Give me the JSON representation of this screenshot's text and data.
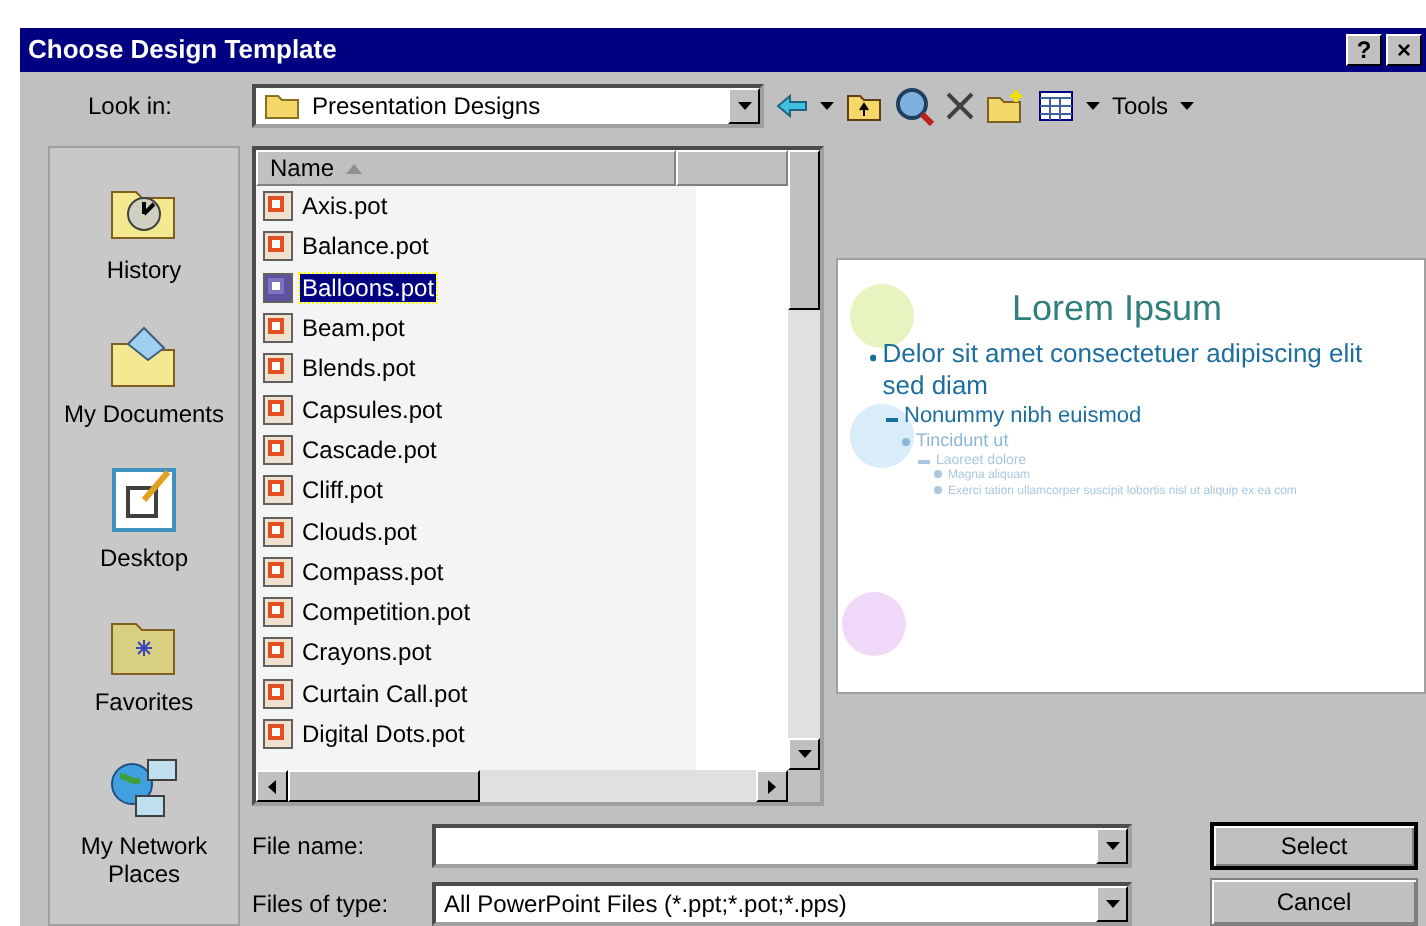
{
  "window": {
    "title": "Choose Design Template",
    "title_buttons": [
      "?",
      "×"
    ]
  },
  "look_in": {
    "label": "Look in:",
    "value": "Presentation Designs"
  },
  "toolbar": {
    "tools_label": "Tools"
  },
  "places": [
    {
      "label": "History",
      "kind": "history"
    },
    {
      "label": "My Documents",
      "kind": "documents"
    },
    {
      "label": "Desktop",
      "kind": "desktop"
    },
    {
      "label": "Favorites",
      "kind": "favorites"
    },
    {
      "label": "My Network Places",
      "kind": "network"
    }
  ],
  "file_list": {
    "column": "Name",
    "files": [
      {
        "name": "Axis.pot",
        "selected": false
      },
      {
        "name": "Balance.pot",
        "selected": false
      },
      {
        "name": "Balloons.pot",
        "selected": true
      },
      {
        "name": "Beam.pot",
        "selected": false
      },
      {
        "name": "Blends.pot",
        "selected": false
      },
      {
        "name": "Capsules.pot",
        "selected": false
      },
      {
        "name": "Cascade.pot",
        "selected": false
      },
      {
        "name": "Cliff.pot",
        "selected": false
      },
      {
        "name": "Clouds.pot",
        "selected": false
      },
      {
        "name": "Compass.pot",
        "selected": false
      },
      {
        "name": "Competition.pot",
        "selected": false
      },
      {
        "name": "Crayons.pot",
        "selected": false
      },
      {
        "name": "Curtain Call.pot",
        "selected": false
      },
      {
        "name": "Digital Dots.pot",
        "selected": false
      }
    ]
  },
  "preview": {
    "title": "Lorem Ipsum",
    "bullets": [
      {
        "text": "Delor sit amet consectetuer adipiscing elit sed diam",
        "children": [
          {
            "text": "Nonummy nibh euismod",
            "children": [
              {
                "text": "Tincidunt ut",
                "children": [
                  {
                    "text": "Laoreet dolore",
                    "children": [
                      {
                        "text": "Magna aliquam"
                      },
                      {
                        "text": "Exerci tation ullamcorper suscipit lobortis nisl ut aliquip ex ea com"
                      }
                    ]
                  }
                ]
              }
            ]
          }
        ]
      }
    ]
  },
  "file_name": {
    "label": "File name:"
  },
  "file_type": {
    "label": "Files of type:",
    "value": "All PowerPoint Files (*.ppt;*.pot;*.pps)"
  },
  "buttons": [
    "Select",
    "Cancel"
  ]
}
